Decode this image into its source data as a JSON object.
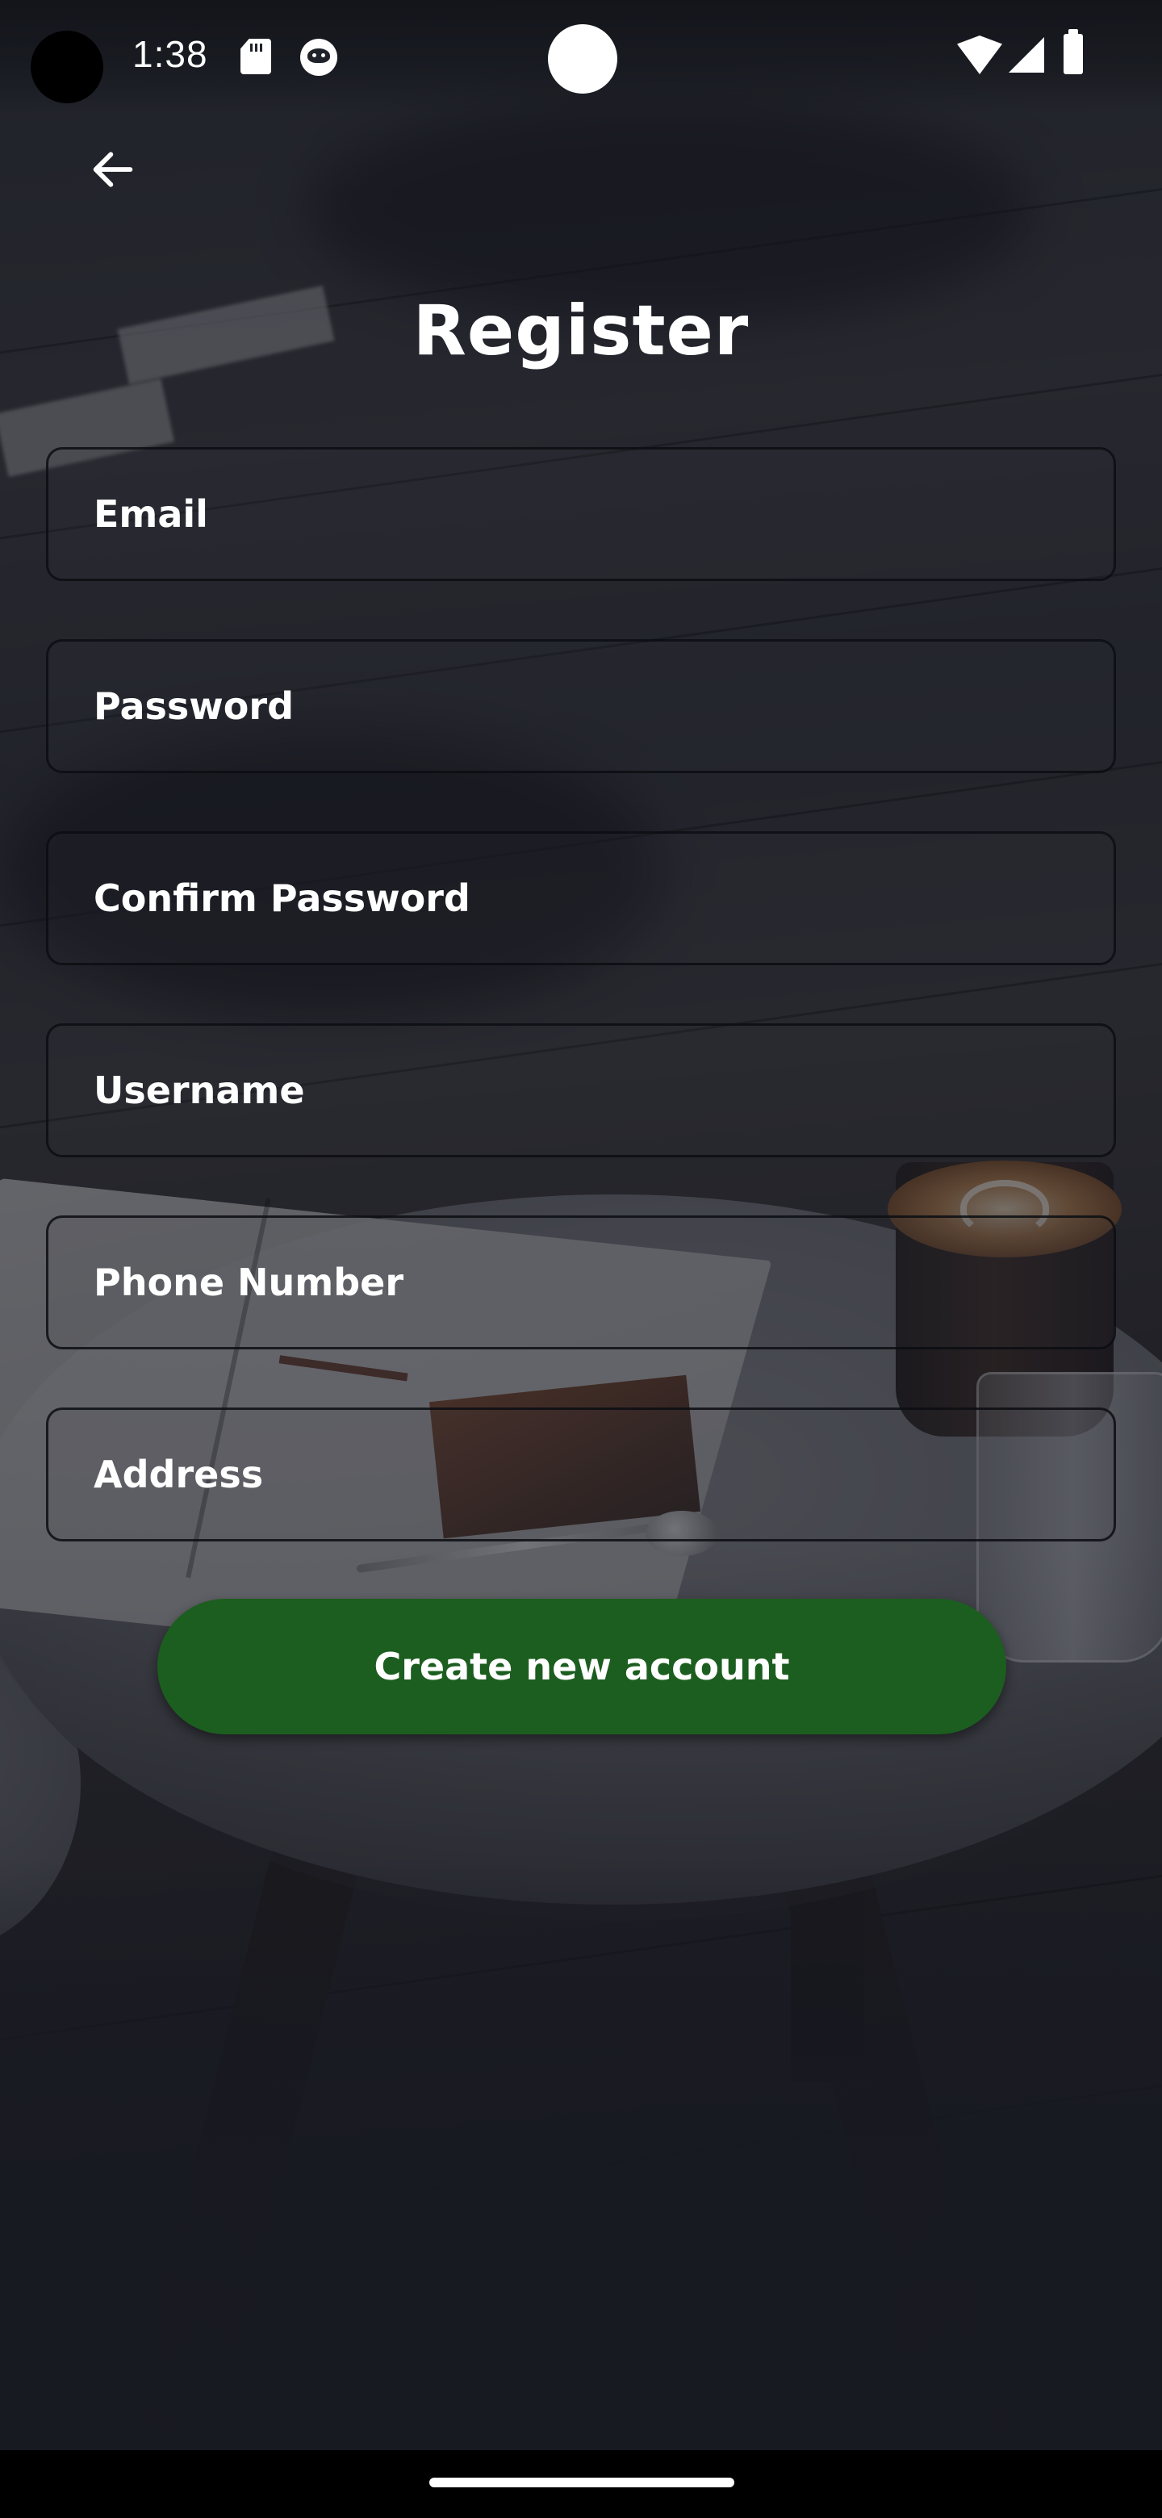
{
  "status_bar": {
    "time": "1:38",
    "icons": [
      "sd-card-icon",
      "notification-cat-icon",
      "camera-dot",
      "wifi-icon",
      "signal-icon",
      "battery-icon"
    ]
  },
  "header": {
    "back_icon": "arrow-left-icon",
    "title": "Register"
  },
  "form": {
    "fields": [
      {
        "placeholder": "Email",
        "value": ""
      },
      {
        "placeholder": "Password",
        "value": ""
      },
      {
        "placeholder": "Confirm Password",
        "value": ""
      },
      {
        "placeholder": "Username",
        "value": ""
      },
      {
        "placeholder": "Phone Number",
        "value": ""
      },
      {
        "placeholder": "Address",
        "value": ""
      }
    ],
    "submit_label": "Create new account"
  },
  "colors": {
    "accent_button": "#1c5e1f",
    "text": "#ffffff",
    "overlay": "#181a22"
  }
}
